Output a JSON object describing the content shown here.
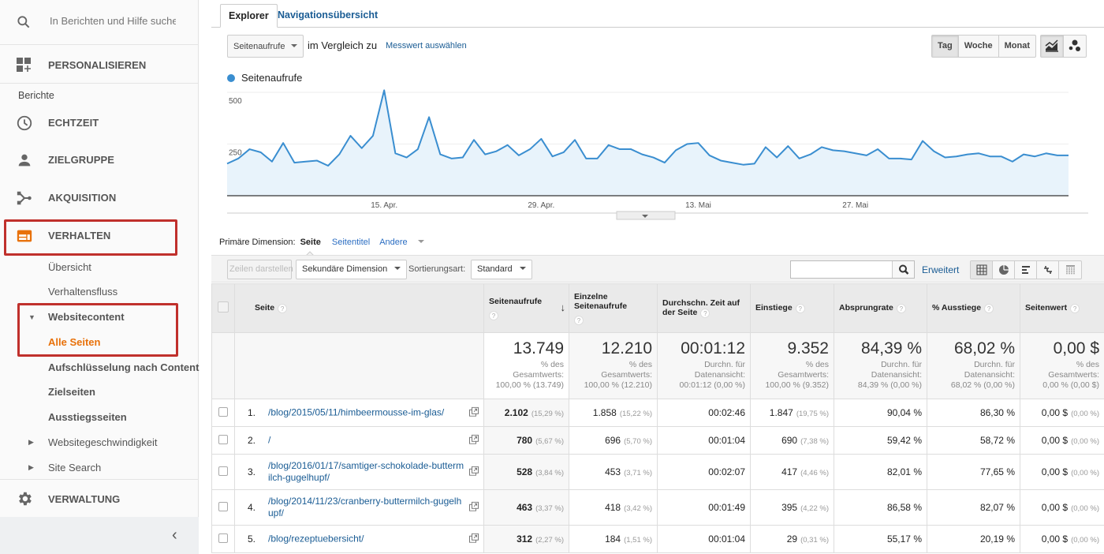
{
  "sidebar": {
    "search_placeholder": "In Berichten und Hilfe suche",
    "personalize_label": "PERSONALISIEREN",
    "section_label": "Berichte",
    "nav": [
      {
        "label": "ECHTZEIT",
        "icon": "clock-icon"
      },
      {
        "label": "ZIELGRUPPE",
        "icon": "person-icon"
      },
      {
        "label": "AKQUISITION",
        "icon": "acquisition-icon"
      },
      {
        "label": "VERHALTEN",
        "icon": "behavior-icon"
      }
    ],
    "behavior_items": {
      "overview": "Übersicht",
      "flow": "Verhaltensfluss",
      "site_content": "Websitecontent",
      "all_pages": "Alle Seiten",
      "content_drilldown": "Aufschlüsselung nach Content",
      "landing_pages": "Zielseiten",
      "exit_pages": "Ausstiegsseiten",
      "site_speed": "Websitegeschwindigkeit",
      "site_search": "Site Search"
    },
    "admin_label": "VERWALTUNG",
    "active_color": "#e8710a",
    "highlight_color": "#c0302c"
  },
  "tabs": {
    "explorer": "Explorer",
    "nav_summary": "Navigationsübersicht"
  },
  "controls": {
    "metric": "Seitenaufrufe",
    "compare_text": "im Vergleich zu",
    "select_metric": "Messwert auswählen",
    "granularity": [
      "Tag",
      "Woche",
      "Monat"
    ],
    "granularity_selected": "Tag"
  },
  "chart_data": {
    "type": "area",
    "title": "",
    "legend": "Seitenaufrufe",
    "color": "#3a8ed0",
    "ylim": [
      0,
      500
    ],
    "yticks": [
      250,
      500
    ],
    "xticks": [
      {
        "label": "15. Apr.",
        "index": 14
      },
      {
        "label": "29. Apr.",
        "index": 28
      },
      {
        "label": "13. Mai",
        "index": 42
      },
      {
        "label": "27. Mai",
        "index": 56
      }
    ],
    "values": [
      155,
      180,
      225,
      210,
      165,
      255,
      160,
      165,
      170,
      145,
      200,
      290,
      230,
      290,
      510,
      205,
      185,
      225,
      380,
      200,
      180,
      185,
      270,
      200,
      215,
      245,
      195,
      225,
      275,
      190,
      210,
      270,
      180,
      180,
      245,
      225,
      225,
      200,
      185,
      160,
      220,
      250,
      255,
      195,
      170,
      160,
      150,
      155,
      235,
      185,
      240,
      180,
      200,
      235,
      220,
      215,
      205,
      195,
      225,
      180,
      180,
      175,
      265,
      215,
      185,
      190,
      200,
      205,
      190,
      190,
      165,
      200,
      190,
      205,
      195,
      195
    ]
  },
  "dimension": {
    "label": "Primäre Dimension:",
    "current": "Seite",
    "alt": "Seitentitel",
    "other": "Andere"
  },
  "toolbar": {
    "plot_rows": "Zeilen darstellen",
    "secondary_dim": "Sekundäre Dimension",
    "sort_label": "Sortierungsart:",
    "sort_value": "Standard",
    "search_value": "",
    "advanced": "Erweitert"
  },
  "table": {
    "columns": [
      "Seite",
      "Seitenaufrufe",
      "Einzelne Seitenaufrufe",
      "Durchschn. Zeit auf der Seite",
      "Einstiege",
      "Absprungrate",
      "% Ausstiege",
      "Seitenwert"
    ],
    "totals": [
      {
        "value": "13.749",
        "l1": "% des",
        "l2": "Gesamtwerts:",
        "l3": "100,00 % (13.749)"
      },
      {
        "value": "12.210",
        "l1": "% des",
        "l2": "Gesamtwerts:",
        "l3": "100,00 % (12.210)"
      },
      {
        "value": "00:01:12",
        "l1": "Durchn. für",
        "l2": "Datenansicht:",
        "l3": "00:01:12 (0,00 %)"
      },
      {
        "value": "9.352",
        "l1": "% des",
        "l2": "Gesamtwerts:",
        "l3": "100,00 % (9.352)"
      },
      {
        "value": "84,39 %",
        "l1": "Durchn. für",
        "l2": "Datenansicht:",
        "l3": "84,39 % (0,00 %)"
      },
      {
        "value": "68,02 %",
        "l1": "Durchn. für",
        "l2": "Datenansicht:",
        "l3": "68,02 % (0,00 %)"
      },
      {
        "value": "0,00 $",
        "l1": "% des",
        "l2": "Gesamtwerts:",
        "l3": "0,00 % (0,00 $)"
      }
    ],
    "rows": [
      {
        "rank": "1.",
        "page": "/blog/2015/05/11/himbeermousse-im-glas/",
        "pv": "2.102",
        "pv_pct": "(15,29 %)",
        "upv": "1.858",
        "upv_pct": "(15,22 %)",
        "time": "00:02:46",
        "ent": "1.847",
        "ent_pct": "(19,75 %)",
        "bounce": "90,04 %",
        "exit": "86,30 %",
        "val": "0,00 $",
        "val_pct": "(0,00 %)"
      },
      {
        "rank": "2.",
        "page": "/",
        "pv": "780",
        "pv_pct": "(5,67 %)",
        "upv": "696",
        "upv_pct": "(5,70 %)",
        "time": "00:01:04",
        "ent": "690",
        "ent_pct": "(7,38 %)",
        "bounce": "59,42 %",
        "exit": "58,72 %",
        "val": "0,00 $",
        "val_pct": "(0,00 %)"
      },
      {
        "rank": "3.",
        "page": "/blog/2016/01/17/samtiger-schokolade-buttermilch-gugelhupf/",
        "pv": "528",
        "pv_pct": "(3,84 %)",
        "upv": "453",
        "upv_pct": "(3,71 %)",
        "time": "00:02:07",
        "ent": "417",
        "ent_pct": "(4,46 %)",
        "bounce": "82,01 %",
        "exit": "77,65 %",
        "val": "0,00 $",
        "val_pct": "(0,00 %)"
      },
      {
        "rank": "4.",
        "page": "/blog/2014/11/23/cranberry-buttermilch-gugelhupf/",
        "pv": "463",
        "pv_pct": "(3,37 %)",
        "upv": "418",
        "upv_pct": "(3,42 %)",
        "time": "00:01:49",
        "ent": "395",
        "ent_pct": "(4,22 %)",
        "bounce": "86,58 %",
        "exit": "82,07 %",
        "val": "0,00 $",
        "val_pct": "(0,00 %)"
      },
      {
        "rank": "5.",
        "page": "/blog/rezeptuebersicht/",
        "pv": "312",
        "pv_pct": "(2,27 %)",
        "upv": "184",
        "upv_pct": "(1,51 %)",
        "time": "00:01:04",
        "ent": "29",
        "ent_pct": "(0,31 %)",
        "bounce": "55,17 %",
        "exit": "20,19 %",
        "val": "0,00 $",
        "val_pct": "(0,00 %)"
      }
    ]
  }
}
